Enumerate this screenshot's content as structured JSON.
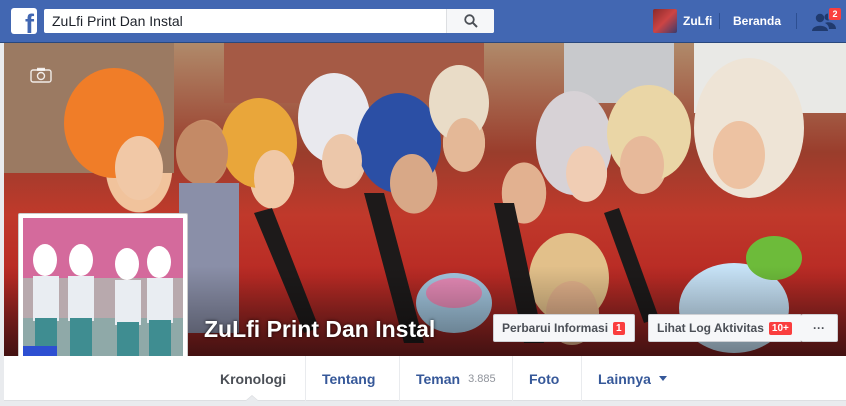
{
  "topbar": {
    "logo_letter": "f",
    "search_value": "ZuLfi Print Dan Instal",
    "user_name": "ZuLfi",
    "home_label": "Beranda",
    "friend_requests_count": "2"
  },
  "profile_header": {
    "page_name": "ZuLfi Print Dan Instal",
    "update_info_label": "Perbarui Informasi",
    "update_info_count": "1",
    "activity_log_label": "Lihat Log Aktivitas",
    "activity_log_count": "10+",
    "more_label": "···"
  },
  "tabs": [
    {
      "label": "Kronologi"
    },
    {
      "label": "Tentang"
    },
    {
      "label": "Teman",
      "count": "3.885"
    },
    {
      "label": "Foto"
    },
    {
      "label": "Lainnya"
    }
  ],
  "colors": {
    "brand_blue": "#4267b2",
    "link_blue": "#365899",
    "notification_red": "#fa3e3e"
  },
  "icons": [
    "facebook-logo-icon",
    "search-icon",
    "friends-icon",
    "camera-icon",
    "caret-down-icon"
  ]
}
